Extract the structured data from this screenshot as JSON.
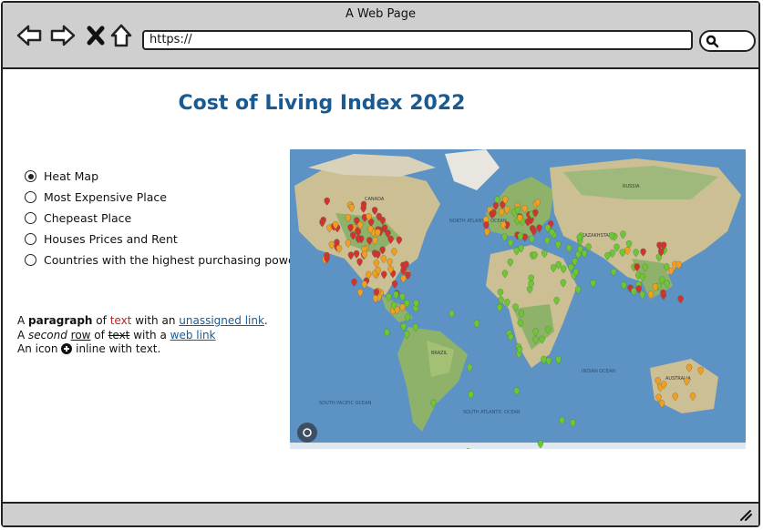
{
  "window": {
    "title": "A Web Page"
  },
  "browser": {
    "url": "https://",
    "back_icon": "back-arrow-icon",
    "forward_icon": "forward-arrow-icon",
    "stop_icon": "close-x-icon",
    "home_icon": "home-icon",
    "search_icon": "search-icon"
  },
  "page": {
    "title": "Cost of Living Index 2022",
    "options": [
      {
        "label": "Heat Map",
        "selected": true
      },
      {
        "label": "Most Expensive Place",
        "selected": false
      },
      {
        "label": "Chepeast Place",
        "selected": false
      },
      {
        "label": "Houses Prices and Rent",
        "selected": false
      },
      {
        "label": "Countries with the highest purchasing power",
        "selected": false
      }
    ],
    "paragraph": {
      "line1": {
        "a": "A ",
        "bold": "paragraph",
        "b": " of ",
        "red": "text",
        "c": " with an ",
        "link": "unassigned link",
        "d": "."
      },
      "line2": {
        "a": "A ",
        "italic": "second",
        "b": " ",
        "underline": "row",
        "c": " of ",
        "strike": "text",
        "d": " with a ",
        "link": "web link"
      },
      "line3": {
        "a": "An icon ",
        "b": " inline with text."
      }
    },
    "map": {
      "labels": {
        "canada": "CANADA",
        "russia": "RUSSIA",
        "kazakhstan": "KAZAKHSTAN",
        "brazil": "BRAZIL",
        "australia": "AUSTRALIA",
        "north_atlantic": "NORTH ATLANTIC OCEAN",
        "south_atlantic": "SOUTH ATLANTIC OCEAN",
        "south_pacific": "SOUTH PACIFIC OCEAN",
        "indian_ocean": "INDIAN OCEAN"
      },
      "colors": {
        "ocean": "#5c93c4",
        "land": "#cbbf93",
        "forest": "#8fb26a",
        "marker_expensive": "#d0342c",
        "marker_mid": "#f0a020",
        "marker_cheap": "#6cc832"
      }
    }
  },
  "status": {
    "grip_icon": "resize-grip-icon"
  }
}
